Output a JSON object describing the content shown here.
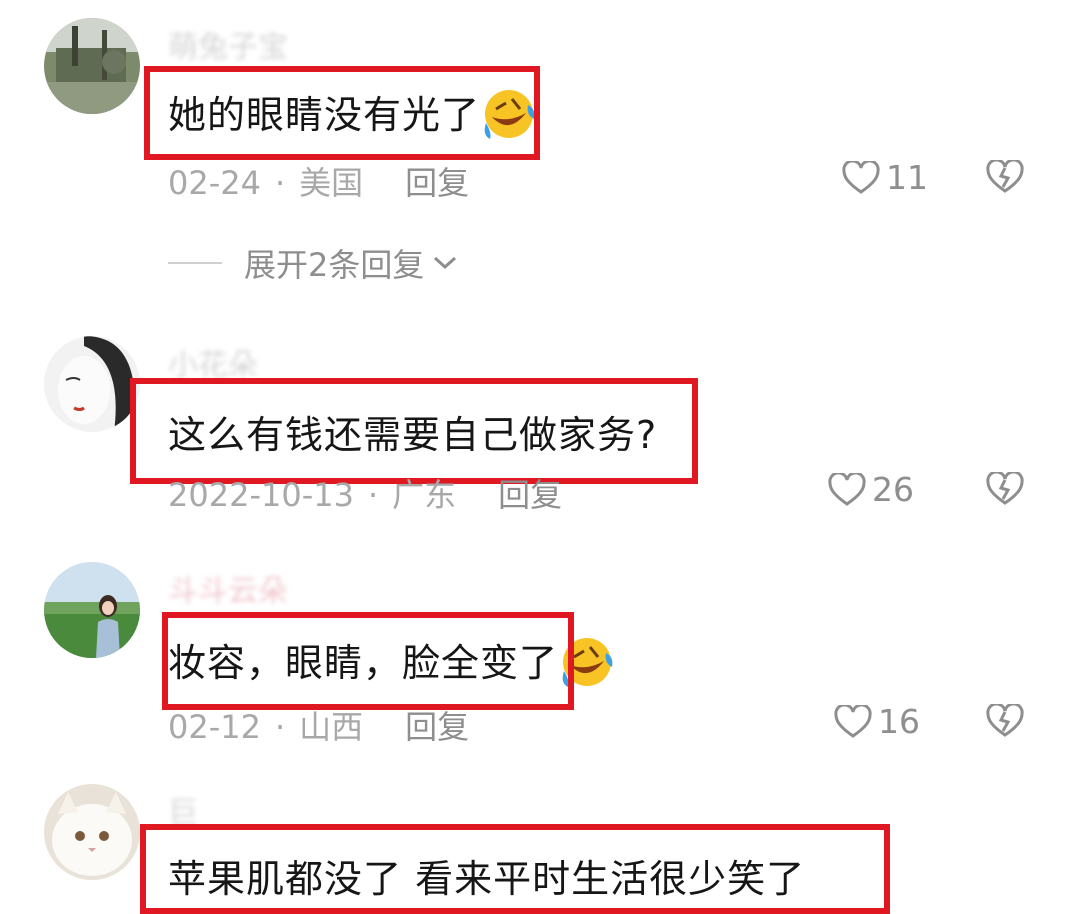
{
  "comments": [
    {
      "username": "萌兔子宝",
      "text": "她的眼睛没有光了",
      "emoji": "rolling-laughing-emoji",
      "date": "02-24",
      "location": "美国",
      "reply_label": "回复",
      "likes": "11",
      "expand_label": "展开2条回复"
    },
    {
      "username": "小花朵",
      "text": "这么有钱还需要自己做家务?",
      "date": "2022-10-13",
      "location": "广东",
      "reply_label": "回复",
      "likes": "26"
    },
    {
      "username": "斗斗云朵",
      "text": "妆容，眼睛，脸全变了",
      "emoji": "rolling-laughing-emoji",
      "date": "02-12",
      "location": "山西",
      "reply_label": "回复",
      "likes": "16"
    },
    {
      "username": "巨",
      "text": "苹果肌都没了 看来平时生活很少笑了"
    }
  ],
  "colors": {
    "highlight": "#e01822",
    "text": "#161616",
    "meta": "#a8a8a8"
  }
}
